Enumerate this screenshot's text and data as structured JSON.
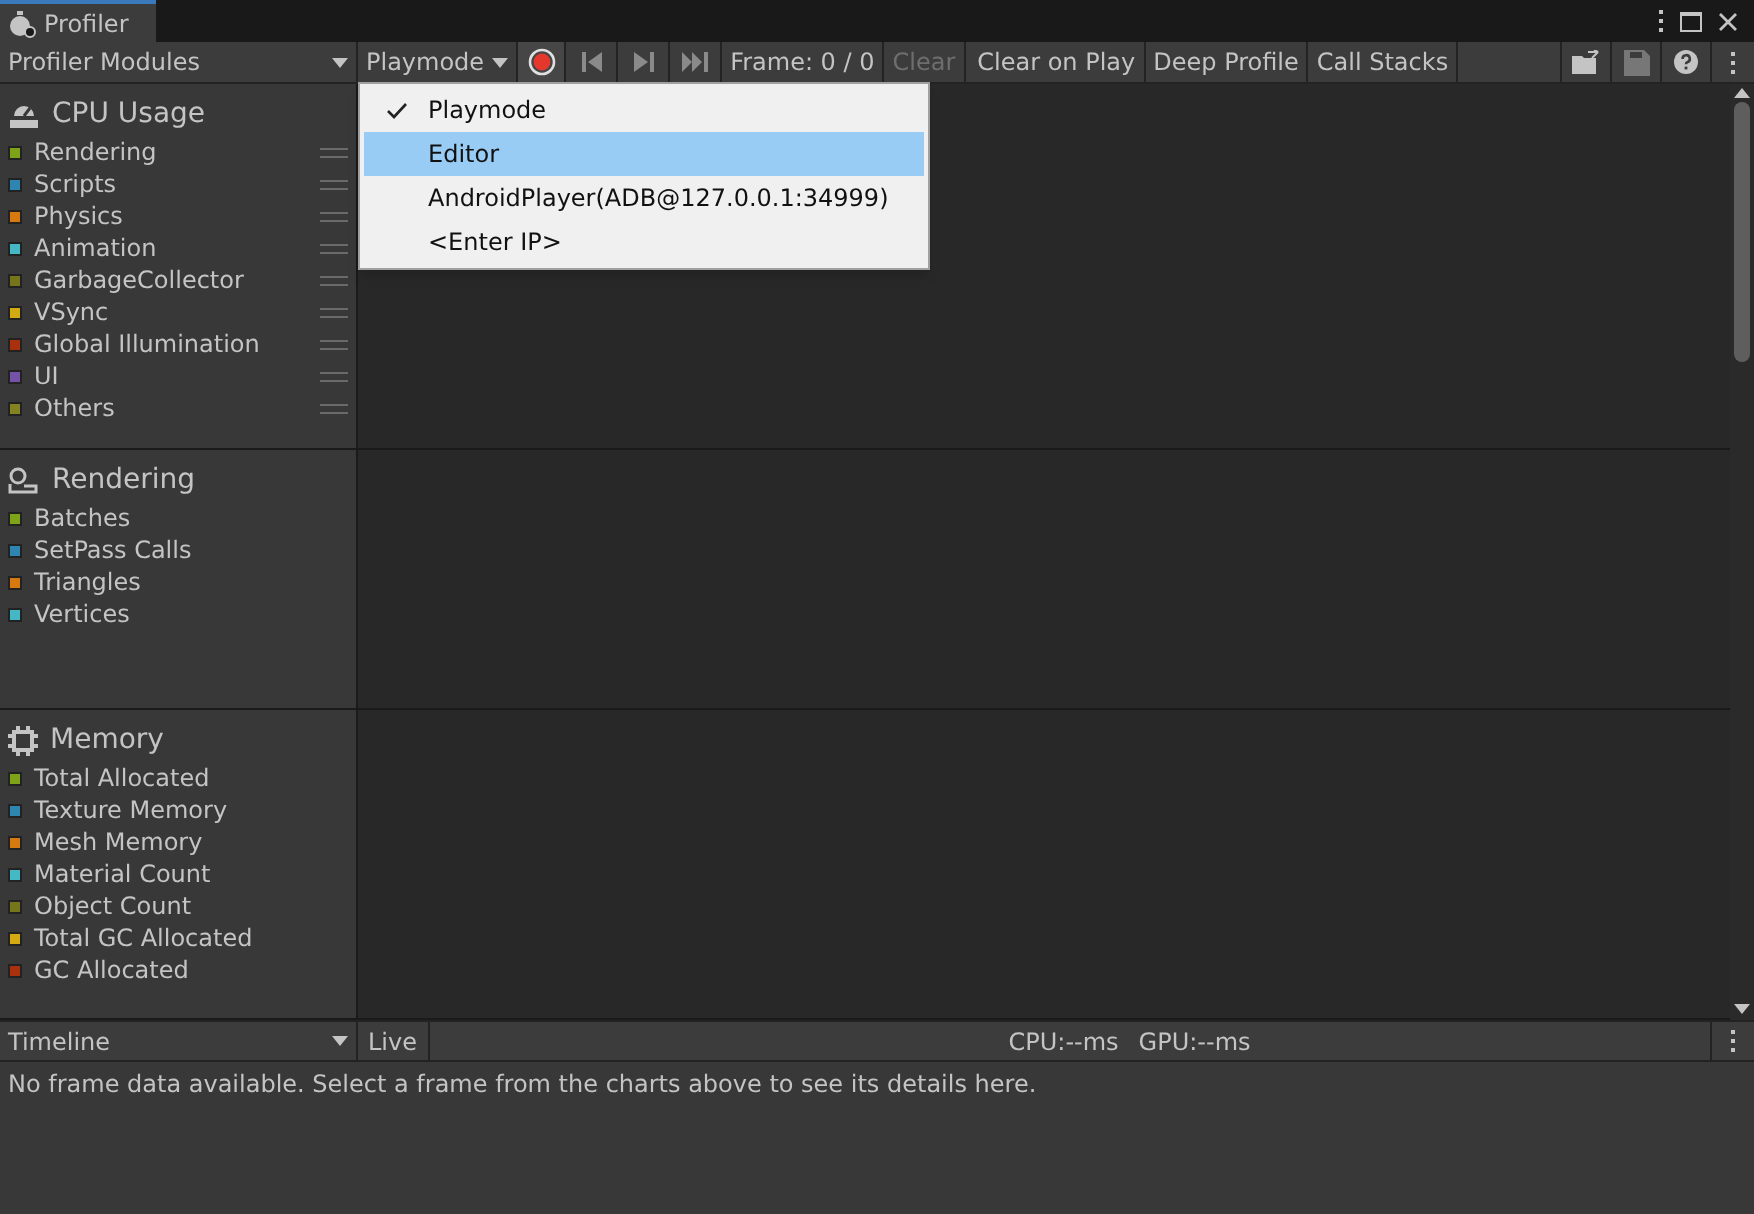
{
  "window": {
    "title": "Profiler"
  },
  "toolbar": {
    "modules_dropdown": "Profiler Modules",
    "target_dropdown": "Playmode",
    "frame": "Frame: 0 / 0",
    "buttons": [
      {
        "label": "Clear",
        "disabled": true
      },
      {
        "label": "Clear on Play",
        "disabled": false
      },
      {
        "label": "Deep Profile",
        "disabled": false
      },
      {
        "label": "Call Stacks",
        "disabled": false
      }
    ]
  },
  "target_menu": [
    {
      "label": "Playmode",
      "checked": true,
      "highlighted": false
    },
    {
      "label": "Editor",
      "checked": false,
      "highlighted": true
    },
    {
      "label": "AndroidPlayer(ADB@127.0.0.1:34999)",
      "checked": false,
      "highlighted": false
    },
    {
      "label": "<Enter IP>",
      "checked": false,
      "highlighted": false
    }
  ],
  "modules": [
    {
      "kind": "cpu",
      "title": "CPU Usage",
      "reorderable": true,
      "items": [
        {
          "name": "Rendering",
          "color": "#7ea318"
        },
        {
          "name": "Scripts",
          "color": "#2e86b0"
        },
        {
          "name": "Physics",
          "color": "#d67a0f"
        },
        {
          "name": "Animation",
          "color": "#44b8c4"
        },
        {
          "name": "GarbageCollector",
          "color": "#75751b"
        },
        {
          "name": "VSync",
          "color": "#d4aa12"
        },
        {
          "name": "Global Illumination",
          "color": "#a8300c"
        },
        {
          "name": "UI",
          "color": "#7452a8"
        },
        {
          "name": "Others",
          "color": "#838321"
        }
      ]
    },
    {
      "kind": "rendering",
      "title": "Rendering",
      "reorderable": false,
      "items": [
        {
          "name": "Batches",
          "color": "#7ea318"
        },
        {
          "name": "SetPass Calls",
          "color": "#2e86b0"
        },
        {
          "name": "Triangles",
          "color": "#d67a0f"
        },
        {
          "name": "Vertices",
          "color": "#44b8c4"
        }
      ]
    },
    {
      "kind": "memory",
      "title": "Memory",
      "reorderable": false,
      "items": [
        {
          "name": "Total Allocated",
          "color": "#7ea318"
        },
        {
          "name": "Texture Memory",
          "color": "#2e86b0"
        },
        {
          "name": "Mesh Memory",
          "color": "#d67a0f"
        },
        {
          "name": "Material Count",
          "color": "#44b8c4"
        },
        {
          "name": "Object Count",
          "color": "#75751b"
        },
        {
          "name": "Total GC Allocated",
          "color": "#d4aa12"
        },
        {
          "name": "GC Allocated",
          "color": "#a8300c"
        }
      ]
    }
  ],
  "details": {
    "view_dropdown": "Timeline",
    "live_button": "Live",
    "cpu": "CPU:--ms",
    "gpu": "GPU:--ms",
    "message": "No frame data available. Select a frame from the charts above to see its details here."
  }
}
